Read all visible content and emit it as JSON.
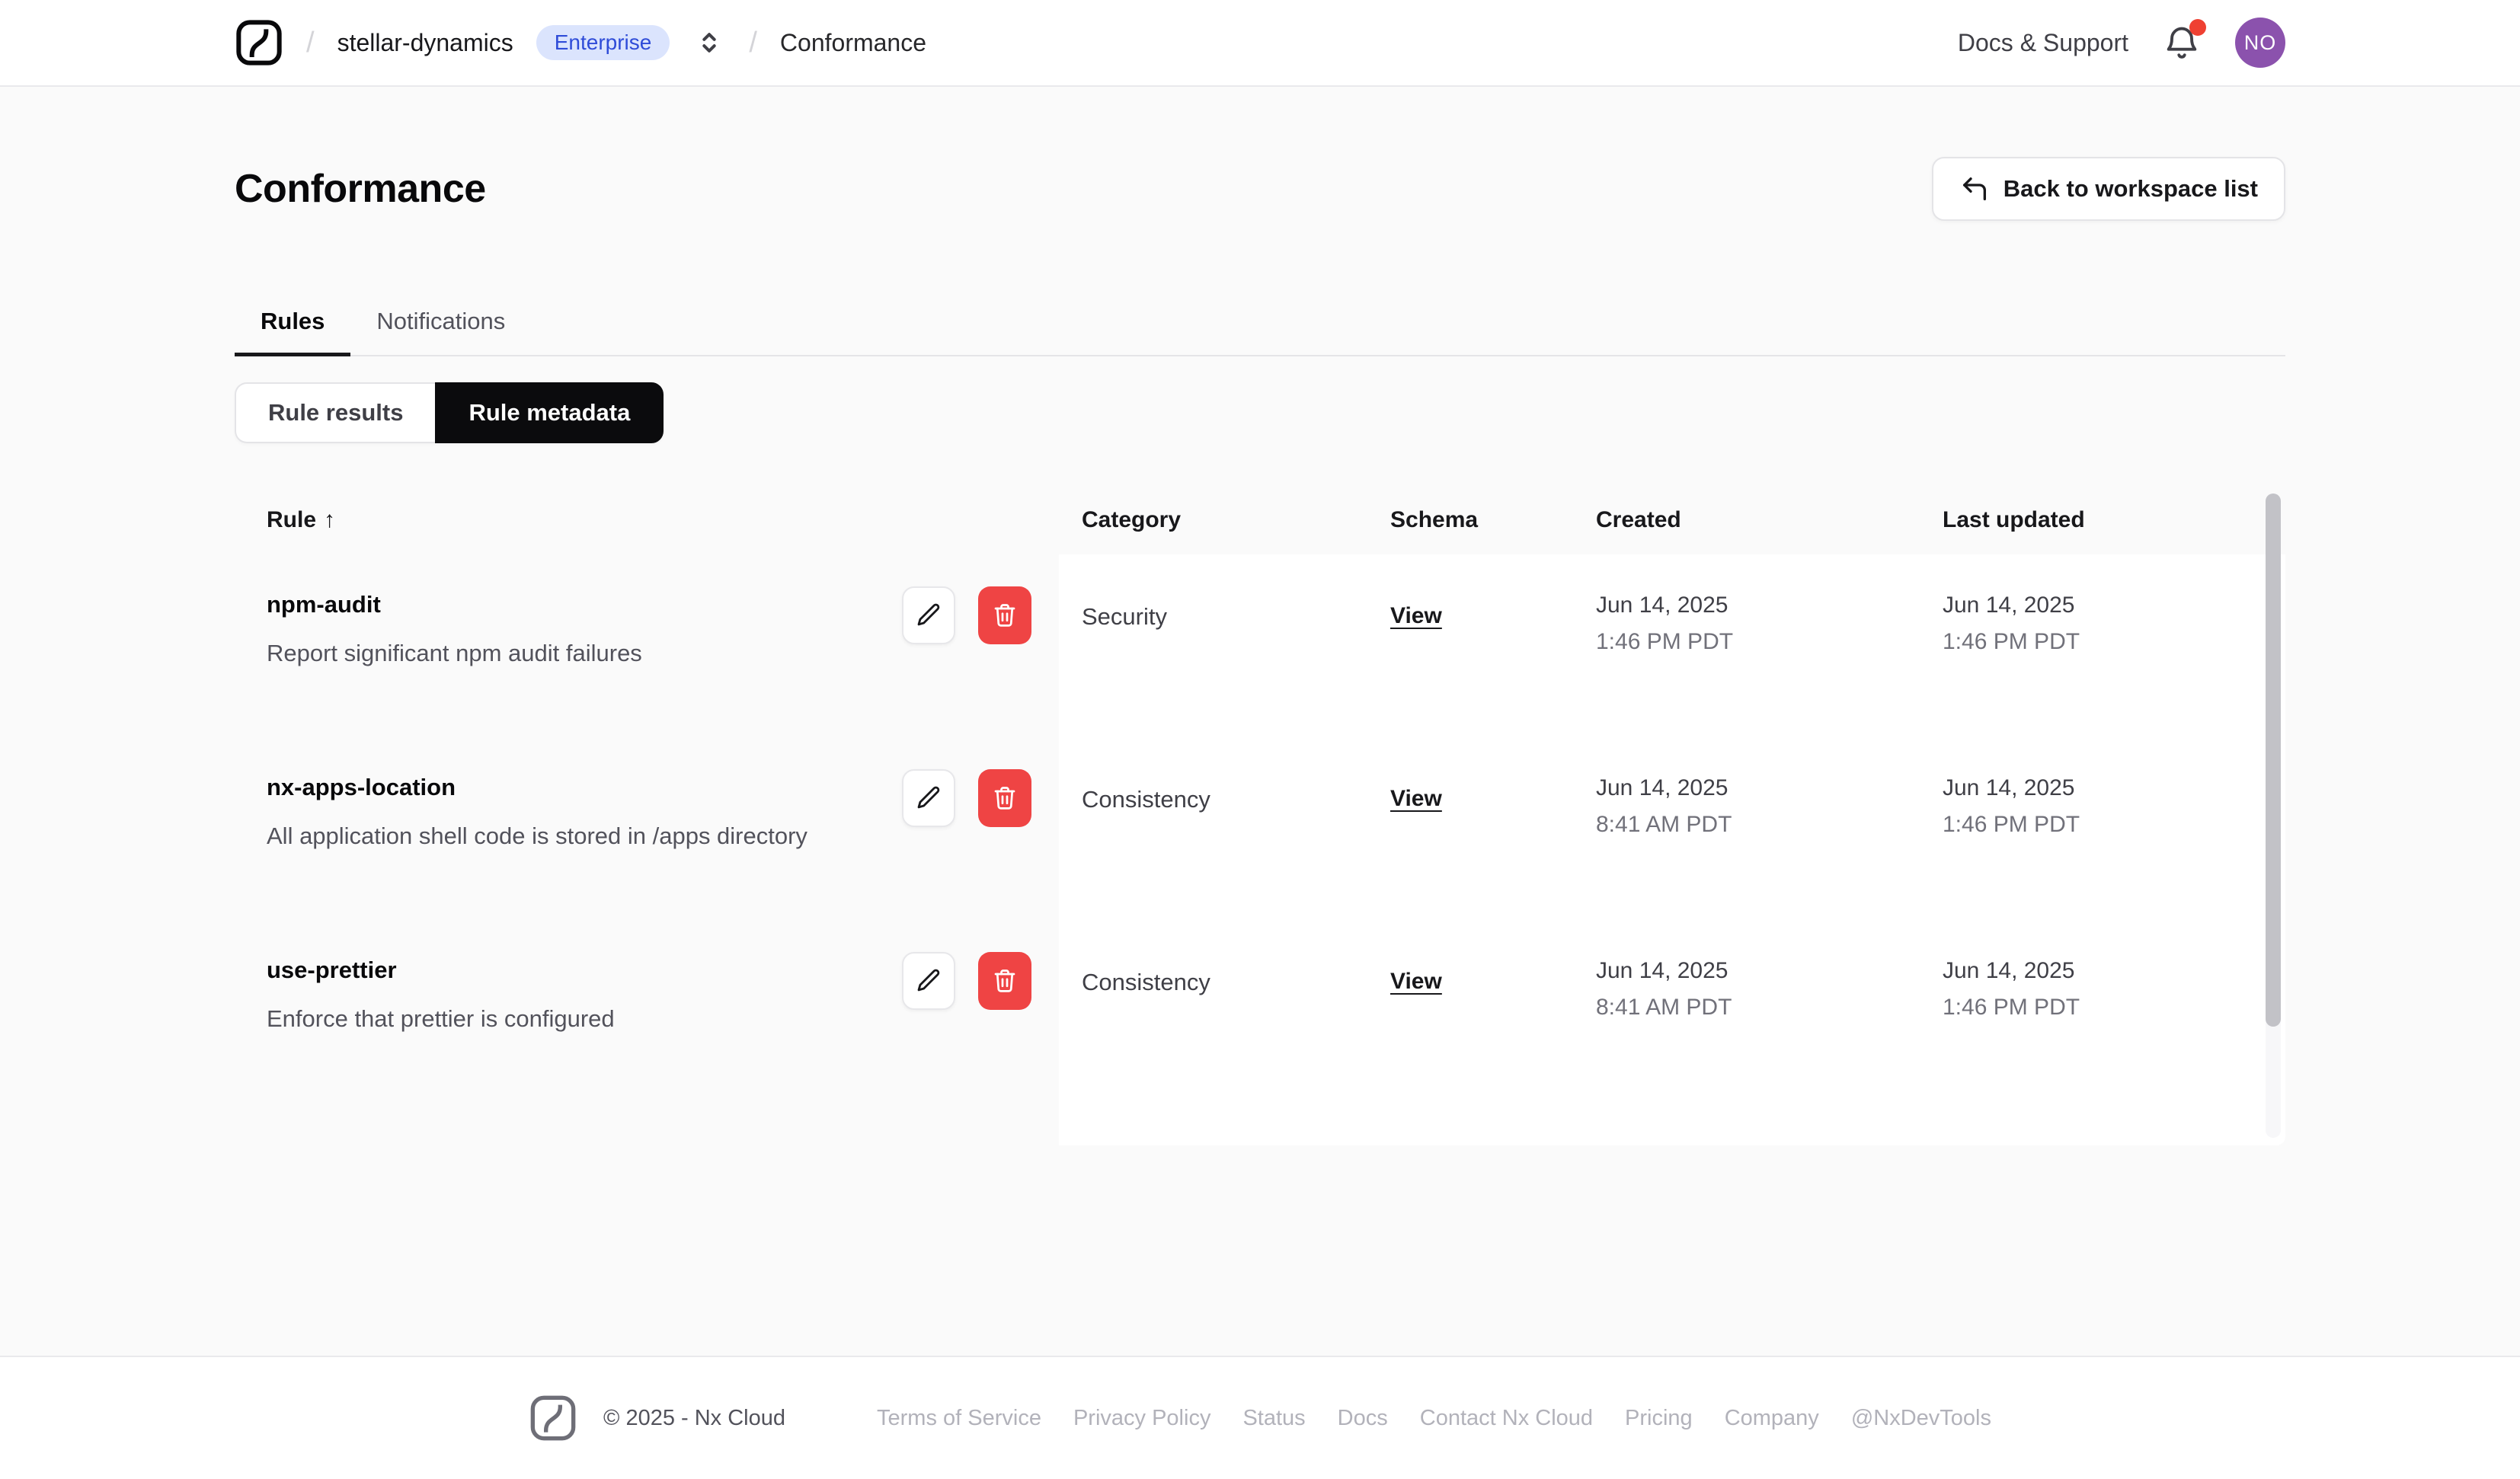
{
  "nav": {
    "breadcrumb": {
      "separator": "/",
      "workspace": "stellar-dynamics",
      "badge": "Enterprise",
      "page": "Conformance"
    },
    "docs_support": "Docs & Support",
    "avatar_initials": "NO"
  },
  "page": {
    "title": "Conformance",
    "back_button_label": "Back to workspace list"
  },
  "tabs": [
    {
      "label": "Rules",
      "active": true
    },
    {
      "label": "Notifications",
      "active": false
    }
  ],
  "toggle": [
    {
      "label": "Rule results",
      "active": false
    },
    {
      "label": "Rule metadata",
      "active": true
    }
  ],
  "table": {
    "columns": [
      "Rule",
      "Category",
      "Schema",
      "Created",
      "Last updated"
    ],
    "sort_indicator": "↑",
    "rows": [
      {
        "name": "npm-audit",
        "description": "Report significant npm audit failures",
        "category": "Security",
        "schema_link": "View",
        "created_date": "Jun 14, 2025",
        "created_time": "1:46 PM PDT",
        "updated_date": "Jun 14, 2025",
        "updated_time": "1:46 PM PDT"
      },
      {
        "name": "nx-apps-location",
        "description": "All application shell code is stored in /apps directory",
        "category": "Consistency",
        "schema_link": "View",
        "created_date": "Jun 14, 2025",
        "created_time": "8:41 AM PDT",
        "updated_date": "Jun 14, 2025",
        "updated_time": "1:46 PM PDT"
      },
      {
        "name": "use-prettier",
        "description": "Enforce that prettier is configured",
        "category": "Consistency",
        "schema_link": "View",
        "created_date": "Jun 14, 2025",
        "created_time": "8:41 AM PDT",
        "updated_date": "Jun 14, 2025",
        "updated_time": "1:46 PM PDT"
      }
    ]
  },
  "footer": {
    "copyright": "© 2025 - Nx Cloud",
    "links": [
      "Terms of Service",
      "Privacy Policy",
      "Status",
      "Docs",
      "Contact Nx Cloud",
      "Pricing",
      "Company",
      "@NxDevTools"
    ]
  },
  "colors": {
    "badge_bg": "#dbe4fd",
    "badge_text": "#2f4cd8",
    "avatar_bg": "#8b52ad",
    "alert_red": "#ef4444",
    "selected_toggle_bg": "#0b0b0d",
    "page_bg": "#fafafa"
  }
}
